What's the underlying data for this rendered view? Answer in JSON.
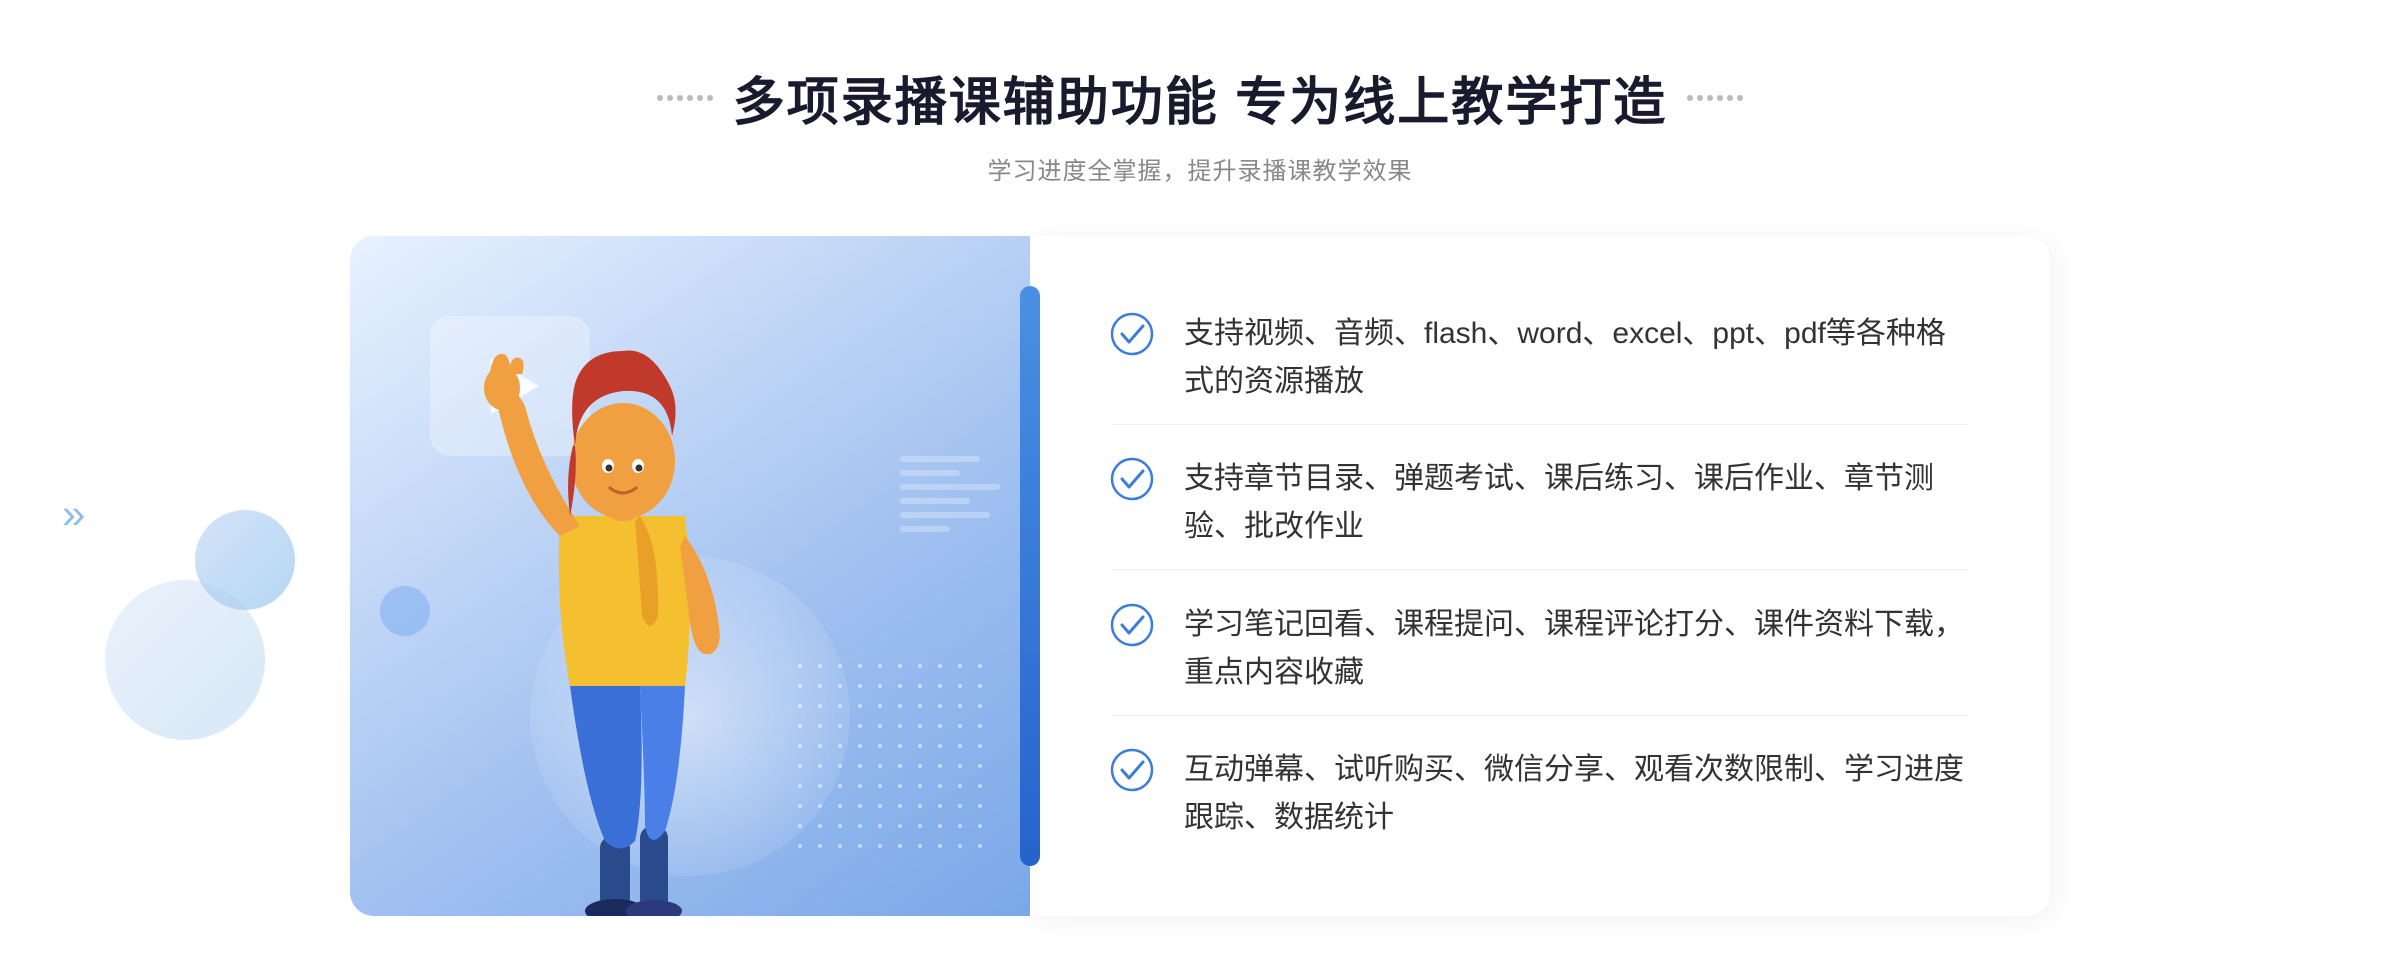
{
  "header": {
    "title": "多项录播课辅助功能 专为线上教学打造",
    "subtitle": "学习进度全掌握，提升录播课教学效果"
  },
  "features": [
    {
      "id": 1,
      "text": "支持视频、音频、flash、word、excel、ppt、pdf等各种格式的资源播放"
    },
    {
      "id": 2,
      "text": "支持章节目录、弹题考试、课后练习、课后作业、章节测验、批改作业"
    },
    {
      "id": 3,
      "text": "学习笔记回看、课程提问、课程评论打分、课件资料下载，重点内容收藏"
    },
    {
      "id": 4,
      "text": "互动弹幕、试听购买、微信分享、观看次数限制、学习进度跟踪、数据统计"
    }
  ],
  "colors": {
    "primary_blue": "#3b7dd8",
    "light_blue": "#a8c8f0",
    "title_color": "#1a1a2e",
    "text_color": "#333333",
    "subtitle_color": "#888888",
    "check_color": "#3b7dd8"
  },
  "decorations": {
    "chevron_left": "»",
    "chevron_right": "::"
  }
}
